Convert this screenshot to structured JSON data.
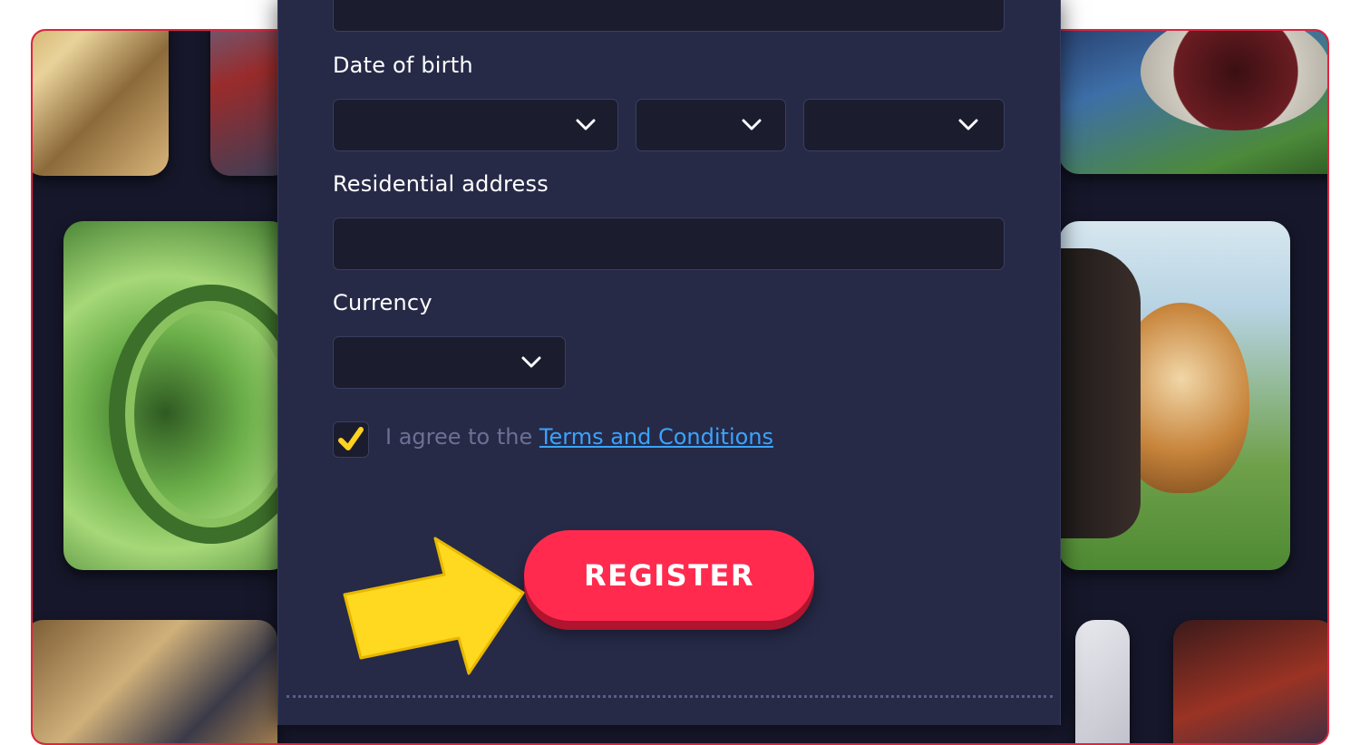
{
  "form": {
    "dob_label": "Date of birth",
    "address_label": "Residential address",
    "address_value": "",
    "currency_label": "Currency",
    "currency_value": "",
    "dob_day_value": "",
    "dob_month_value": "",
    "dob_year_value": "",
    "agree_prefix": "I agree to the",
    "terms_link": "Terms and Conditions",
    "terms_checked": true,
    "register_label": "REGISTER"
  },
  "colors": {
    "accent": "#ff2a4e",
    "panel": "#262a47",
    "link": "#3aa3ff",
    "checkmark": "#ffd21f",
    "frame_border": "#e0243f"
  },
  "icons": {
    "select_arrow": "chevron-down-icon",
    "check": "check-icon",
    "pointer": "arrow-pointer-icon"
  }
}
